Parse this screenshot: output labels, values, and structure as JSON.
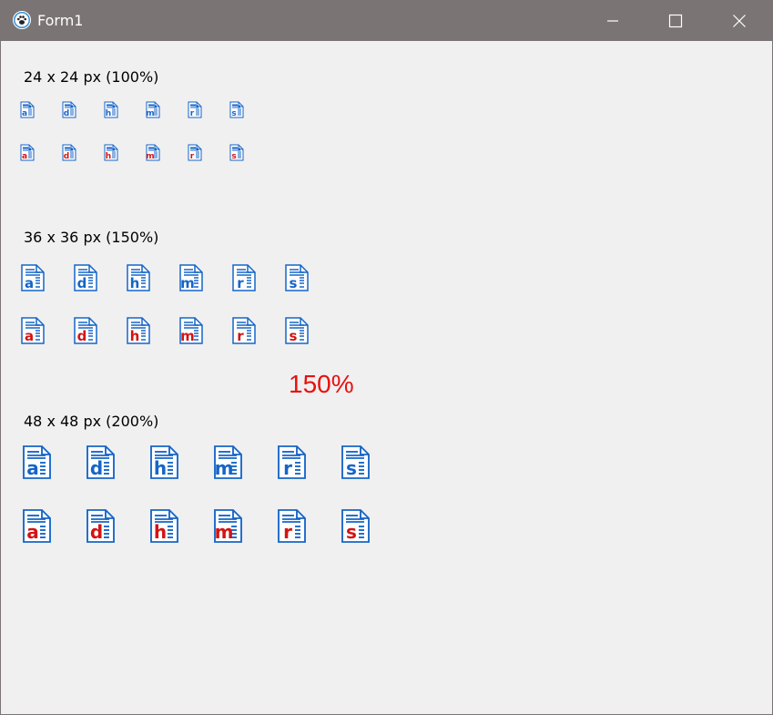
{
  "window": {
    "title": "Form1",
    "icon": "paw-icon",
    "controls": [
      "minimize-icon",
      "maximize-icon",
      "close-icon"
    ]
  },
  "groups": [
    {
      "label": "24 x 24 px (100%)",
      "letters": [
        "a",
        "d",
        "h",
        "m",
        "r",
        "s"
      ],
      "rows": [
        {
          "letter_color": "#1565c8"
        },
        {
          "letter_color": "#d21414"
        }
      ]
    },
    {
      "label": "36 x 36 px (150%)",
      "letters": [
        "a",
        "d",
        "h",
        "m",
        "r",
        "s"
      ],
      "rows": [
        {
          "letter_color": "#1565c8"
        },
        {
          "letter_color": "#d21414"
        }
      ]
    },
    {
      "label": "48 x 48 px (200%)",
      "letters": [
        "a",
        "d",
        "h",
        "m",
        "r",
        "s"
      ],
      "rows": [
        {
          "letter_color": "#1565c8"
        },
        {
          "letter_color": "#d21414"
        }
      ]
    }
  ],
  "scale_note": "150%",
  "colors": {
    "titlebar": "#7a7574",
    "icon_outline": "#1565c8",
    "scale_note": "#e8110f"
  }
}
